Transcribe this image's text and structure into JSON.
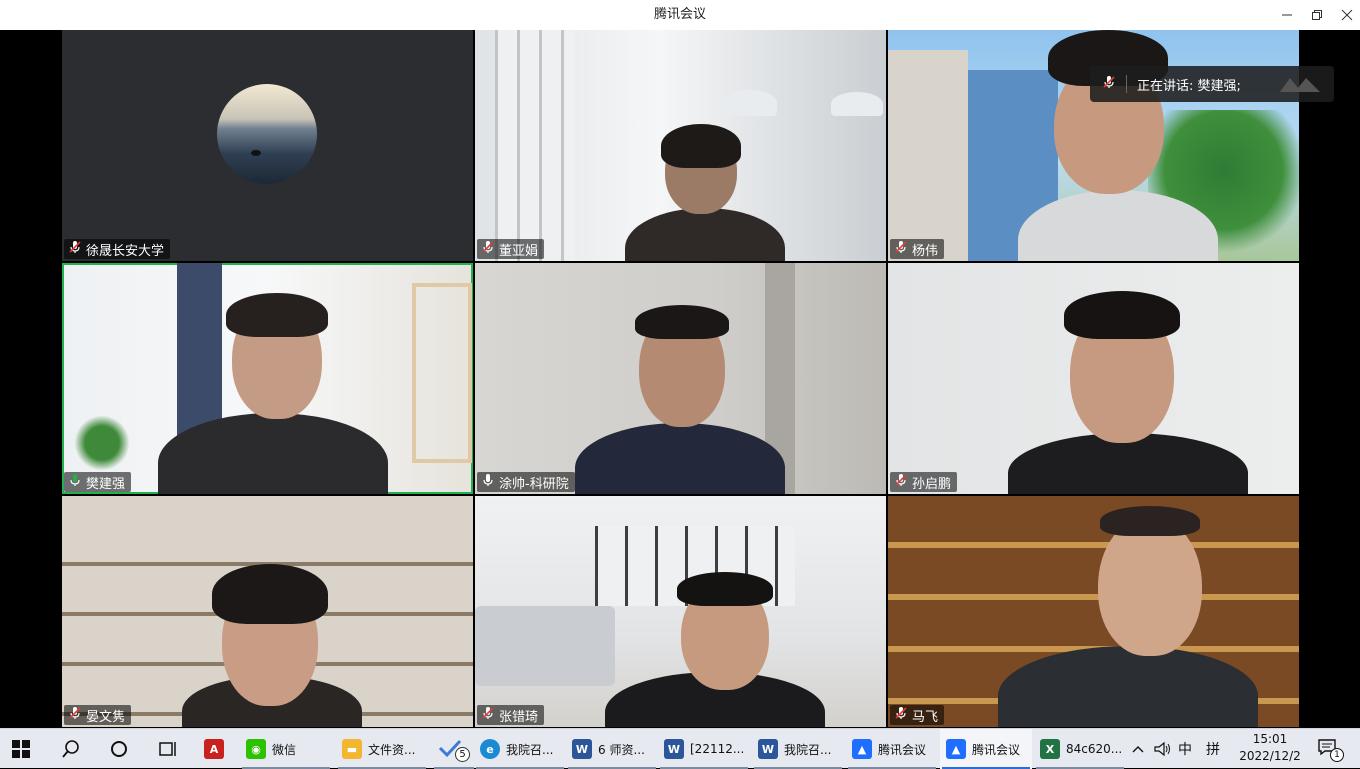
{
  "window": {
    "title": "腾讯会议"
  },
  "speaker_popup": {
    "text": "正在讲话: 樊建强;"
  },
  "tiles": [
    {
      "name": "徐晟长安大学",
      "mic": "muted"
    },
    {
      "name": "董亚娟",
      "mic": "muted"
    },
    {
      "name": "杨伟",
      "mic": "muted"
    },
    {
      "name": "樊建强",
      "mic": "speaking"
    },
    {
      "name": "涂帅-科研院",
      "mic": "on"
    },
    {
      "name": "孙启鹏",
      "mic": "muted"
    },
    {
      "name": "晏文隽",
      "mic": "muted"
    },
    {
      "name": "张错琦",
      "mic": "muted"
    },
    {
      "name": "马飞",
      "mic": "muted"
    }
  ],
  "taskbar": {
    "apps": [
      {
        "label": "微信",
        "icon": "wechat-icon",
        "color": "#2dc100"
      },
      {
        "label": "文件资...",
        "icon": "folder-icon",
        "color": "#f2b630"
      },
      {
        "label": "",
        "badge": "5",
        "icon": "todo-icon",
        "color": "#3a7bd5"
      },
      {
        "label": "我院召...",
        "icon": "edge-icon",
        "color": "#1a8ad4"
      },
      {
        "label": "6 师资...",
        "icon": "word-icon",
        "color": "#2b579a"
      },
      {
        "label": "[22112...",
        "icon": "word-icon",
        "color": "#2b579a"
      },
      {
        "label": "我院召...",
        "icon": "word-icon",
        "color": "#2b579a"
      },
      {
        "label": "腾讯会议",
        "icon": "tencent-meeting-icon",
        "color": "#1e6fff"
      },
      {
        "label": "腾讯会议",
        "icon": "tencent-meeting-icon",
        "color": "#1e6fff"
      },
      {
        "label": "84c620...",
        "icon": "excel-icon",
        "color": "#217346"
      }
    ],
    "tray": {
      "ime_lang": "中",
      "ime_mode": "拼",
      "time": "15:01",
      "date": "2022/12/2",
      "notification_count": "1"
    }
  },
  "colors": {
    "active_speaker_border": "#22b14c",
    "muted_mic": "#e03b3b"
  }
}
